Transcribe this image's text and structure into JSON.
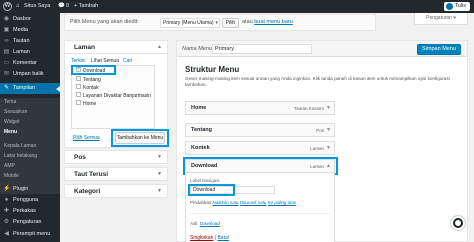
{
  "adminbar": {
    "site_name": "Situs Saya",
    "comments": "0",
    "new_label": "+ Tambah",
    "howdy": "Tulis"
  },
  "sidebar": {
    "items": [
      {
        "label": "Dasbor",
        "icon": "dashboard-icon"
      },
      {
        "label": "Media",
        "icon": "media-icon"
      },
      {
        "label": "Tautan",
        "icon": "links-icon"
      },
      {
        "label": "Laman",
        "icon": "pages-icon"
      },
      {
        "label": "Komentar",
        "icon": "comments-icon"
      },
      {
        "label": "Umpan balik",
        "icon": "feedback-icon"
      },
      {
        "label": "Tampilan",
        "icon": "appearance-icon"
      }
    ],
    "submenu": [
      "Tema",
      "Sesuaikan",
      "Widget",
      "Menu",
      "Kepala Laman",
      "Latar belakang",
      "AMP",
      "Mobile"
    ],
    "lower_items": [
      {
        "label": "Plugin",
        "icon": "plugins-icon"
      },
      {
        "label": "Pengguna",
        "icon": "users-icon"
      },
      {
        "label": "Perkakas",
        "icon": "tools-icon"
      },
      {
        "label": "Pengaturan",
        "icon": "settings-icon"
      },
      {
        "label": "Perampit menu",
        "icon": "collapse-icon"
      }
    ]
  },
  "manage": {
    "label": "Pilih Menu yang akan diedit:",
    "selected": "Primary (Menu Utama)",
    "select_button": "Pilih",
    "or_text": "atau",
    "create_link": "buat menu baru"
  },
  "screen_options": "Pengaturan ▾",
  "left": {
    "laman_title": "Laman",
    "tabs": [
      "Terkini",
      "Lihat Semua",
      "Cari"
    ],
    "pages": [
      {
        "label": "Download",
        "checked": true
      },
      {
        "label": "Tentang",
        "checked": false
      },
      {
        "label": "Kontak",
        "checked": false
      },
      {
        "label": "Layanan Divaktar Banjarmasin",
        "checked": false
      },
      {
        "label": "Home",
        "checked": false
      }
    ],
    "select_all": "Pilih Semua",
    "add_button": "Tambahkan ke Menu",
    "sections": [
      "Pos",
      "Taut Terusi",
      "Kategori"
    ]
  },
  "right": {
    "menu_name_label": "Nama Menu",
    "menu_name_value": "Primary",
    "save_button": "Simpan Menu",
    "structure_title": "Struktur Menu",
    "description": "Geser masing-masing item sesuai urutan yang Anda inginkan. Klik tanda panah di kanan item untuk menampilkan opsi konfigurasi tambahan.",
    "items": [
      {
        "title": "Home",
        "type": "Tautan Kustom"
      },
      {
        "title": "Tentang",
        "type": "Pos"
      },
      {
        "title": "Kontek",
        "type": "Laman"
      },
      {
        "title": "Download",
        "type": "Laman"
      }
    ],
    "nav_label_caption": "Label Navigasi",
    "nav_label_value": "Download",
    "move_prefix": "Pindahkan",
    "move_links": [
      "Naikkan satu",
      "Diturunk satu",
      "Ke paling atas"
    ],
    "original_prefix": "Asli:",
    "original_link": "Download",
    "remove": "Singkirkan",
    "separator": "|",
    "cancel": "Batal"
  }
}
